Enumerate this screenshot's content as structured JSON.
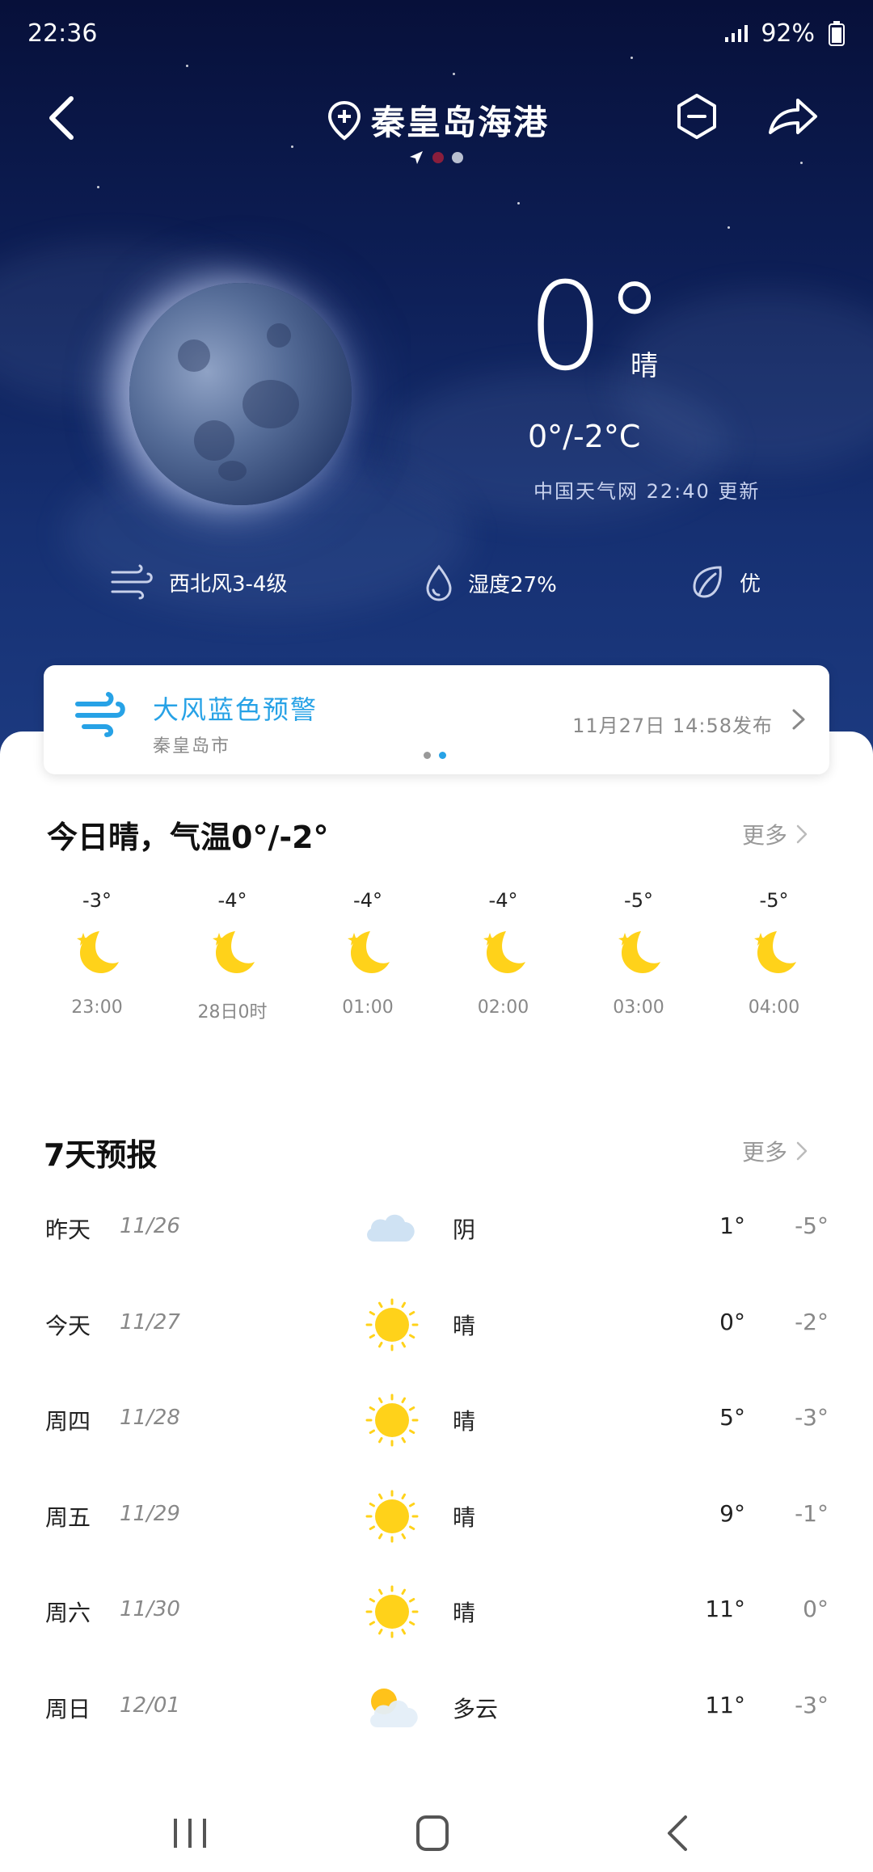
{
  "status": {
    "time": "22:36",
    "battery": "92%"
  },
  "header": {
    "title": "秦皇岛海港"
  },
  "current": {
    "temp": "0°",
    "condition": "晴",
    "range": "0°/-2°C",
    "source": "中国天气网 22:40 更新",
    "wind": "西北风3-4级",
    "humidity": "湿度27%",
    "aqi": "优"
  },
  "alert": {
    "title": "大风蓝色预警",
    "region": "秦皇岛市",
    "time": "11月27日 14:58发布"
  },
  "today": {
    "title": "今日晴，气温0°/-2°",
    "more": "更多",
    "hours": [
      {
        "temp": "-3°",
        "time": "23:00",
        "icon": "moon-star-icon"
      },
      {
        "temp": "-4°",
        "time": "28日0时",
        "icon": "moon-star-icon"
      },
      {
        "temp": "-4°",
        "time": "01:00",
        "icon": "moon-star-icon"
      },
      {
        "temp": "-4°",
        "time": "02:00",
        "icon": "moon-star-icon"
      },
      {
        "temp": "-5°",
        "time": "03:00",
        "icon": "moon-star-icon"
      },
      {
        "temp": "-5°",
        "time": "04:00",
        "icon": "moon-star-icon"
      }
    ]
  },
  "forecast": {
    "title": "7天预报",
    "more": "更多",
    "days": [
      {
        "name": "昨天",
        "date": "11/26",
        "cond": "阴",
        "high": "1°",
        "low": "-5°",
        "icon": "cloud-icon"
      },
      {
        "name": "今天",
        "date": "11/27",
        "cond": "晴",
        "high": "0°",
        "low": "-2°",
        "icon": "sun-icon"
      },
      {
        "name": "周四",
        "date": "11/28",
        "cond": "晴",
        "high": "5°",
        "low": "-3°",
        "icon": "sun-icon"
      },
      {
        "name": "周五",
        "date": "11/29",
        "cond": "晴",
        "high": "9°",
        "low": "-1°",
        "icon": "sun-icon"
      },
      {
        "name": "周六",
        "date": "11/30",
        "cond": "晴",
        "high": "11°",
        "low": "0°",
        "icon": "sun-icon"
      },
      {
        "name": "周日",
        "date": "12/01",
        "cond": "多云",
        "high": "11°",
        "low": "-3°",
        "icon": "partly-cloudy-icon"
      }
    ]
  },
  "colors": {
    "accent": "#27a2e6",
    "sun": "#ffd21a",
    "hero_top": "#07103a"
  }
}
